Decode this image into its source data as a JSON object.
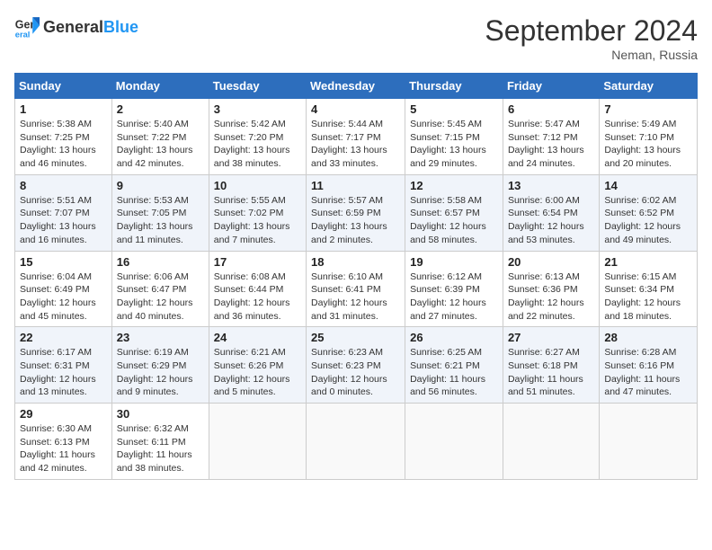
{
  "header": {
    "logo_general": "General",
    "logo_blue": "Blue",
    "month_year": "September 2024",
    "location": "Neman, Russia"
  },
  "days_of_week": [
    "Sunday",
    "Monday",
    "Tuesday",
    "Wednesday",
    "Thursday",
    "Friday",
    "Saturday"
  ],
  "weeks": [
    [
      {
        "day": "1",
        "detail": "Sunrise: 5:38 AM\nSunset: 7:25 PM\nDaylight: 13 hours\nand 46 minutes."
      },
      {
        "day": "2",
        "detail": "Sunrise: 5:40 AM\nSunset: 7:22 PM\nDaylight: 13 hours\nand 42 minutes."
      },
      {
        "day": "3",
        "detail": "Sunrise: 5:42 AM\nSunset: 7:20 PM\nDaylight: 13 hours\nand 38 minutes."
      },
      {
        "day": "4",
        "detail": "Sunrise: 5:44 AM\nSunset: 7:17 PM\nDaylight: 13 hours\nand 33 minutes."
      },
      {
        "day": "5",
        "detail": "Sunrise: 5:45 AM\nSunset: 7:15 PM\nDaylight: 13 hours\nand 29 minutes."
      },
      {
        "day": "6",
        "detail": "Sunrise: 5:47 AM\nSunset: 7:12 PM\nDaylight: 13 hours\nand 24 minutes."
      },
      {
        "day": "7",
        "detail": "Sunrise: 5:49 AM\nSunset: 7:10 PM\nDaylight: 13 hours\nand 20 minutes."
      }
    ],
    [
      {
        "day": "8",
        "detail": "Sunrise: 5:51 AM\nSunset: 7:07 PM\nDaylight: 13 hours\nand 16 minutes."
      },
      {
        "day": "9",
        "detail": "Sunrise: 5:53 AM\nSunset: 7:05 PM\nDaylight: 13 hours\nand 11 minutes."
      },
      {
        "day": "10",
        "detail": "Sunrise: 5:55 AM\nSunset: 7:02 PM\nDaylight: 13 hours\nand 7 minutes."
      },
      {
        "day": "11",
        "detail": "Sunrise: 5:57 AM\nSunset: 6:59 PM\nDaylight: 13 hours\nand 2 minutes."
      },
      {
        "day": "12",
        "detail": "Sunrise: 5:58 AM\nSunset: 6:57 PM\nDaylight: 12 hours\nand 58 minutes."
      },
      {
        "day": "13",
        "detail": "Sunrise: 6:00 AM\nSunset: 6:54 PM\nDaylight: 12 hours\nand 53 minutes."
      },
      {
        "day": "14",
        "detail": "Sunrise: 6:02 AM\nSunset: 6:52 PM\nDaylight: 12 hours\nand 49 minutes."
      }
    ],
    [
      {
        "day": "15",
        "detail": "Sunrise: 6:04 AM\nSunset: 6:49 PM\nDaylight: 12 hours\nand 45 minutes."
      },
      {
        "day": "16",
        "detail": "Sunrise: 6:06 AM\nSunset: 6:47 PM\nDaylight: 12 hours\nand 40 minutes."
      },
      {
        "day": "17",
        "detail": "Sunrise: 6:08 AM\nSunset: 6:44 PM\nDaylight: 12 hours\nand 36 minutes."
      },
      {
        "day": "18",
        "detail": "Sunrise: 6:10 AM\nSunset: 6:41 PM\nDaylight: 12 hours\nand 31 minutes."
      },
      {
        "day": "19",
        "detail": "Sunrise: 6:12 AM\nSunset: 6:39 PM\nDaylight: 12 hours\nand 27 minutes."
      },
      {
        "day": "20",
        "detail": "Sunrise: 6:13 AM\nSunset: 6:36 PM\nDaylight: 12 hours\nand 22 minutes."
      },
      {
        "day": "21",
        "detail": "Sunrise: 6:15 AM\nSunset: 6:34 PM\nDaylight: 12 hours\nand 18 minutes."
      }
    ],
    [
      {
        "day": "22",
        "detail": "Sunrise: 6:17 AM\nSunset: 6:31 PM\nDaylight: 12 hours\nand 13 minutes."
      },
      {
        "day": "23",
        "detail": "Sunrise: 6:19 AM\nSunset: 6:29 PM\nDaylight: 12 hours\nand 9 minutes."
      },
      {
        "day": "24",
        "detail": "Sunrise: 6:21 AM\nSunset: 6:26 PM\nDaylight: 12 hours\nand 5 minutes."
      },
      {
        "day": "25",
        "detail": "Sunrise: 6:23 AM\nSunset: 6:23 PM\nDaylight: 12 hours\nand 0 minutes."
      },
      {
        "day": "26",
        "detail": "Sunrise: 6:25 AM\nSunset: 6:21 PM\nDaylight: 11 hours\nand 56 minutes."
      },
      {
        "day": "27",
        "detail": "Sunrise: 6:27 AM\nSunset: 6:18 PM\nDaylight: 11 hours\nand 51 minutes."
      },
      {
        "day": "28",
        "detail": "Sunrise: 6:28 AM\nSunset: 6:16 PM\nDaylight: 11 hours\nand 47 minutes."
      }
    ],
    [
      {
        "day": "29",
        "detail": "Sunrise: 6:30 AM\nSunset: 6:13 PM\nDaylight: 11 hours\nand 42 minutes."
      },
      {
        "day": "30",
        "detail": "Sunrise: 6:32 AM\nSunset: 6:11 PM\nDaylight: 11 hours\nand 38 minutes."
      },
      {
        "day": "",
        "detail": ""
      },
      {
        "day": "",
        "detail": ""
      },
      {
        "day": "",
        "detail": ""
      },
      {
        "day": "",
        "detail": ""
      },
      {
        "day": "",
        "detail": ""
      }
    ]
  ]
}
